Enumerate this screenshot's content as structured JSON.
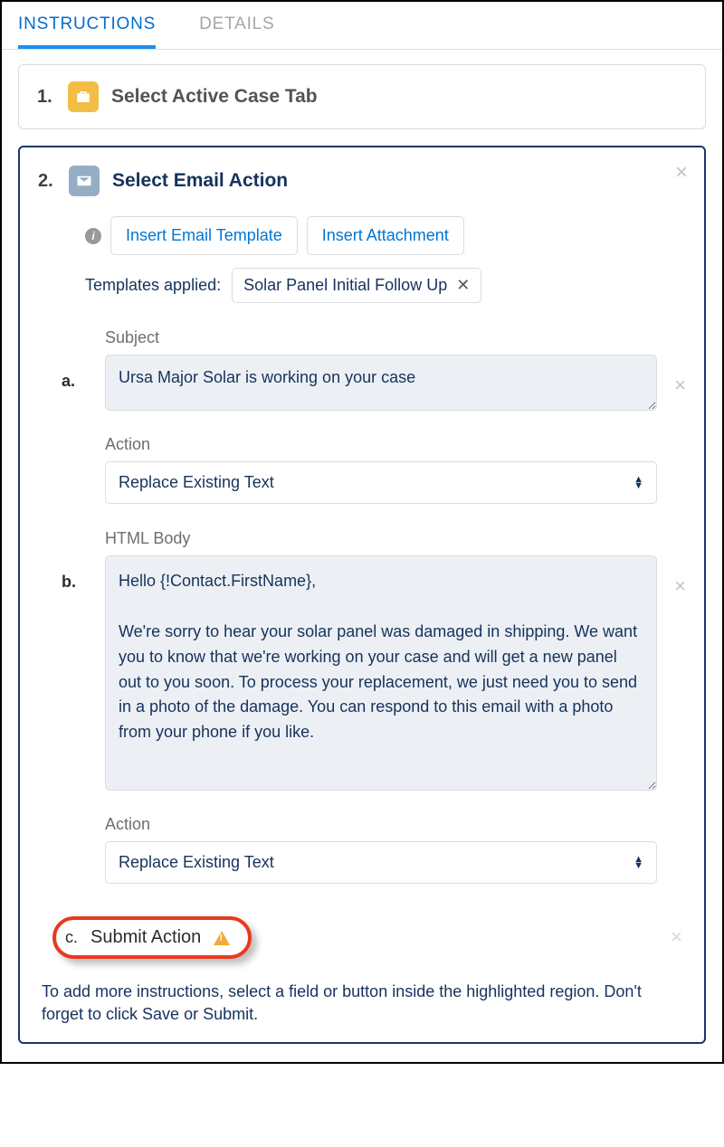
{
  "tabs": {
    "instructions": "INSTRUCTIONS",
    "details": "DETAILS"
  },
  "step1": {
    "number": "1.",
    "title": "Select Active Case Tab"
  },
  "step2": {
    "number": "2.",
    "title": "Select Email Action",
    "buttons": {
      "insertTemplate": "Insert Email Template",
      "insertAttachment": "Insert Attachment"
    },
    "templatesLabel": "Templates applied:",
    "templateChip": "Solar Panel Initial Follow Up",
    "sub_a": {
      "letter": "a.",
      "subjectLabel": "Subject",
      "subjectValue": "Ursa Major Solar is working on your case",
      "actionLabel": "Action",
      "actionValue": "Replace Existing Text"
    },
    "sub_b": {
      "letter": "b.",
      "bodyLabel": "HTML Body",
      "bodyValue": "Hello {!Contact.FirstName},\n\nWe're sorry to hear your solar panel was damaged in shipping. We want you to know that we're working on your case and will get a new panel out to you soon. To process your replacement, we just need you to send in a photo of the damage. You can respond to this email with a photo from your phone if you like.",
      "actionLabel": "Action",
      "actionValue": "Replace Existing Text"
    },
    "sub_c": {
      "letter": "c.",
      "title": "Submit Action"
    },
    "helpText": "To add more instructions, select a field or button inside the highlighted region. Don't forget to click Save or Submit."
  }
}
